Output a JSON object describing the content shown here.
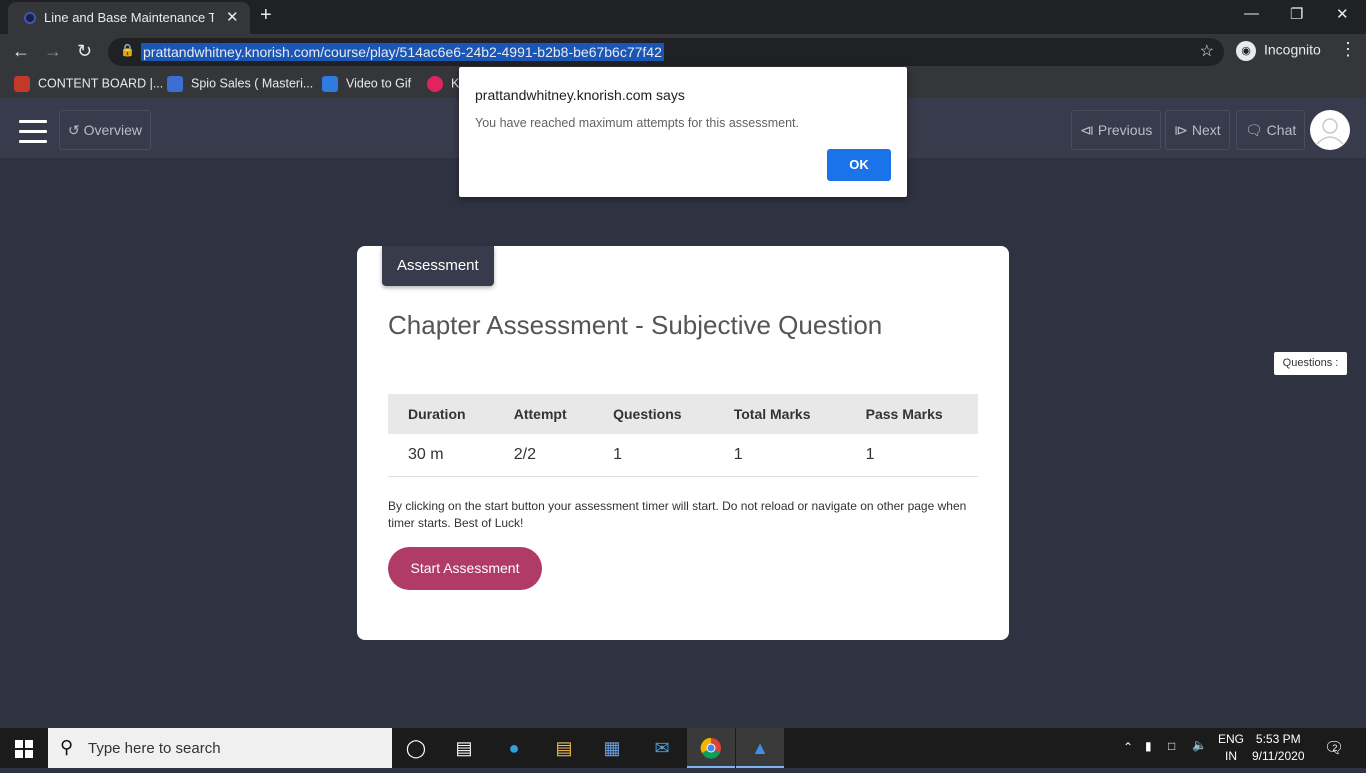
{
  "browser": {
    "tab_title": "Line and Base Maintenance Training",
    "tab_close": "✕",
    "new_tab": "+",
    "url": "prattandwhitney.knorish.com/course/play/514ac6e6-24b2-4991-b2b8-be67b6c77f42",
    "incognito_label": "Incognito",
    "bookmarks": [
      {
        "label": "CONTENT BOARD |...",
        "color": "#c0392b"
      },
      {
        "label": "Spio Sales ( Masteri...",
        "color": "#3b6fd4"
      },
      {
        "label": "Video to Gif",
        "color": "#2f7be0"
      },
      {
        "label": "K...",
        "color": "#e0245e"
      }
    ]
  },
  "dialog": {
    "title": "prattandwhitney.knorish.com says",
    "message": "You have reached maximum attempts for this assessment.",
    "ok_label": "OK"
  },
  "header": {
    "overview_label": "Overview",
    "previous_label": "Previous",
    "next_label": "Next",
    "chat_label": "Chat"
  },
  "card": {
    "tag": "Assessment",
    "title": "Chapter Assessment - Subjective Question",
    "columns": [
      "Duration",
      "Attempt",
      "Questions",
      "Total Marks",
      "Pass Marks"
    ],
    "values": [
      "30 m",
      "2/2",
      "1",
      "1",
      "1"
    ],
    "note": "By clicking on the start button your assessment timer will start. Do not reload or navigate on other page when timer starts. Best of Luck!",
    "start_label": "Start Assessment"
  },
  "questions_badge": "Questions :",
  "taskbar": {
    "search_placeholder": "Type here to search",
    "lang_line1": "ENG",
    "lang_line2": "IN",
    "time": "5:53 PM",
    "date": "9/11/2020",
    "notification_count": "2"
  },
  "colors": {
    "accent_button": "#b03b67",
    "dialog_ok": "#1a73e8",
    "app_background": "#2f3241",
    "header_background": "#383b4b"
  }
}
